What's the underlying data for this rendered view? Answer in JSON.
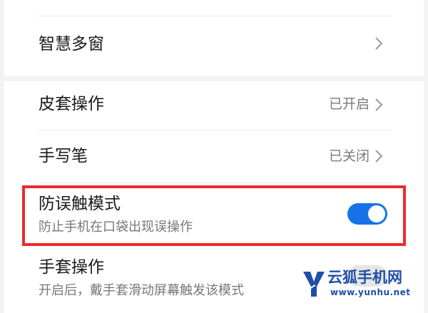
{
  "settings": {
    "smart_multiwindow": {
      "title": "智慧多窗",
      "chevron_icon": "chevron-right-icon"
    },
    "cover_operation": {
      "title": "皮套操作",
      "status": "已开启",
      "chevron_icon": "chevron-right-icon"
    },
    "stylus": {
      "title": "手写笔",
      "status": "已关闭",
      "chevron_icon": "chevron-right-icon"
    },
    "accidental_touch": {
      "title": "防误触模式",
      "subtitle": "防止手机在口袋出现误操作",
      "toggle_on": true
    },
    "glove_mode": {
      "title": "手套操作",
      "subtitle": "开启后，戴手套滑动屏幕触发该模式"
    }
  },
  "watermark": {
    "name": "云狐手机网",
    "url": "www.yunhu.net"
  },
  "colors": {
    "toggle_on": "#1673e6",
    "highlight_border": "#ea2b2b",
    "watermark": "#1f4fa8"
  }
}
